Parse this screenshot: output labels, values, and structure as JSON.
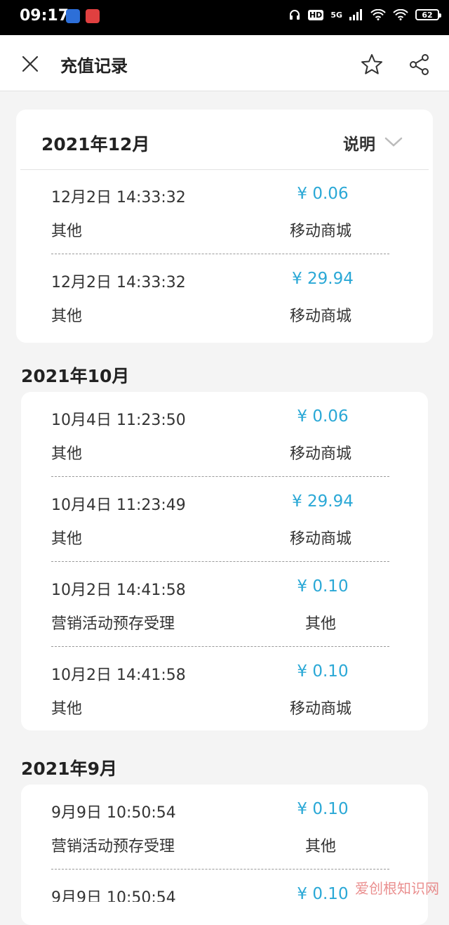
{
  "status": {
    "time": "09:17",
    "net_label": "5G",
    "hd_label": "HD",
    "battery": "62"
  },
  "header": {
    "title": "充值记录"
  },
  "sections": [
    {
      "month": "2021年12月",
      "explain_label": "说明",
      "records": [
        {
          "date": "12月2日 14:33:32",
          "amount": "¥ 0.06",
          "kind": "其他",
          "channel": "移动商城"
        },
        {
          "date": "12月2日 14:33:32",
          "amount": "¥ 29.94",
          "kind": "其他",
          "channel": "移动商城"
        }
      ]
    },
    {
      "month": "2021年10月",
      "records": [
        {
          "date": "10月4日 11:23:50",
          "amount": "¥ 0.06",
          "kind": "其他",
          "channel": "移动商城"
        },
        {
          "date": "10月4日 11:23:49",
          "amount": "¥ 29.94",
          "kind": "其他",
          "channel": "移动商城"
        },
        {
          "date": "10月2日 14:41:58",
          "amount": "¥ 0.10",
          "kind": "营销活动预存受理",
          "channel": "其他"
        },
        {
          "date": "10月2日 14:41:58",
          "amount": "¥ 0.10",
          "kind": "其他",
          "channel": "移动商城"
        }
      ]
    },
    {
      "month": "2021年9月",
      "records": [
        {
          "date": "9月9日 10:50:54",
          "amount": "¥ 0.10",
          "kind": "营销活动预存受理",
          "channel": "其他"
        },
        {
          "date": "9月9日 10:50:54",
          "amount": "¥ 0.10",
          "kind": "",
          "channel": ""
        }
      ]
    }
  ],
  "watermark": "爱创根知识网",
  "colors": {
    "amount": "#2aa8d6",
    "background": "#f4f4f4"
  }
}
